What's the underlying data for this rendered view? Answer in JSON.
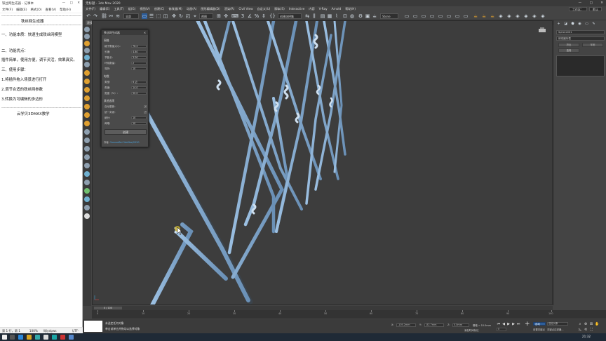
{
  "colors": {
    "wire": "#8fb4d8",
    "wire_dark": "#5f84a8",
    "viewport_bg": "#3d3d3d",
    "cursor_highlight": "#c8b030"
  },
  "notepad": {
    "title": "铁丝网生成器 - 记事本",
    "window_controls": [
      "—",
      "□",
      "✕"
    ],
    "menu": [
      "文件(F)",
      "编辑(E)",
      "格式(O)",
      "查看(V)",
      "帮助(H)"
    ],
    "lines": [
      "-------------------------------------------------------------",
      "铁丝网生成器",
      "-------------------------------------------------------------",
      "一、功能本质：快速生成铁丝网模型",
      "二、功能优点：",
      "插件简单，使用方便，调节灵活，效果真实。",
      "三、使用步骤：",
      "1.将插件拖入场景进行打开",
      "2.调节合适的铁丝网参数",
      "3.转换为可编辑的多边形",
      "-------------------------------------------------------------",
      "云学贝3DMAX教学"
    ],
    "status": [
      "第 1 行，第 1 列",
      "100%",
      "Windows (CRLF)",
      "UTF-8"
    ]
  },
  "max": {
    "title": "无标题 - 3ds Max 2020",
    "window_controls": [
      "—",
      "□",
      "✕"
    ],
    "menu": [
      "文件(F)",
      "编辑(E)",
      "工具(T)",
      "组(G)",
      "视图(V)",
      "创建(C)",
      "修改器(M)",
      "动画(A)",
      "图形编辑器(D)",
      "渲染(R)",
      "Civil View",
      "自定义(U)",
      "脚本(S)",
      "Interactive",
      "内容",
      "V-Ray",
      "Arnold",
      "帮助(H)"
    ],
    "workspace_label": "工作区：",
    "workspace_value": "默认",
    "toolbar": {
      "all_dropdown": "全部",
      "view_dropdown": "视图",
      "selection_set": "创建选择集",
      "create_selection": "Stone"
    },
    "ribbon_tabs": [
      "建模",
      "自由形式",
      "选择",
      "对象绘制",
      "填充"
    ],
    "viewport_label": "[+] [透视] [标准] [默认明暗处理]"
  },
  "dialog": {
    "title": "铁丝网生成器",
    "close": "✕",
    "sections": {
      "mesh": "网格",
      "wire": "电缆",
      "other": "其他选项"
    },
    "mesh_rows": [
      {
        "label": "格子数量大小:",
        "value": "76.2"
      },
      {
        "label": "长度:",
        "value": "4.80"
      },
      {
        "label": "节距长:",
        "value": "3.00"
      },
      {
        "label": "环绕数量:",
        "value": "2"
      },
      {
        "label": "弯折:",
        "value": "10"
      }
    ],
    "wire_rows": [
      {
        "label": "类型:",
        "value": "6 边"
      },
      {
        "label": "角度:",
        "value": "14.0"
      },
      {
        "label": "宽度（%）:",
        "value": "50.0"
      }
    ],
    "other_rows": [
      {
        "label": "自动更新:",
        "value": "✔"
      },
      {
        "label": "统一封闭:",
        "value": "✔"
      },
      {
        "label": "细分:",
        "value": "10"
      },
      {
        "label": "两端:",
        "value": "10"
      }
    ],
    "create_button": "创建",
    "footer_label": "作者:",
    "footer_link": "YunxueBei 3dsMax/2020"
  },
  "command_panel": {
    "tabs": [
      "+",
      "◪",
      "⬟",
      "◉",
      "▭",
      "✎"
    ],
    "search_field": "Sphere001",
    "modifier_list": "修改器列表",
    "buttons": [
      "挤出",
      "车削",
      "晶格"
    ]
  },
  "timeline": {
    "slider": "0 / 100",
    "ticks": [
      "0",
      "10",
      "20",
      "30",
      "40",
      "50",
      "60",
      "70",
      "80",
      "90",
      "100"
    ]
  },
  "status_bar": {
    "line1": "未选定任何对象",
    "line2": "单击或单击并拖动以选择对象",
    "x_label": "X:",
    "x_value": "-105.2mm",
    "y_label": "Y:",
    "y_value": "-82.7mm",
    "z_label": "Z:",
    "z_value": "0.0mm",
    "grid": "栅格 = 10.0mm",
    "autokey": "自动",
    "selected": "选定对象",
    "setkey": "设置关键点",
    "key_filters": "关键点过滤器...",
    "add_time_tag": "添加时间标记",
    "frame": "0"
  },
  "taskbar": {
    "time": "21:32"
  }
}
